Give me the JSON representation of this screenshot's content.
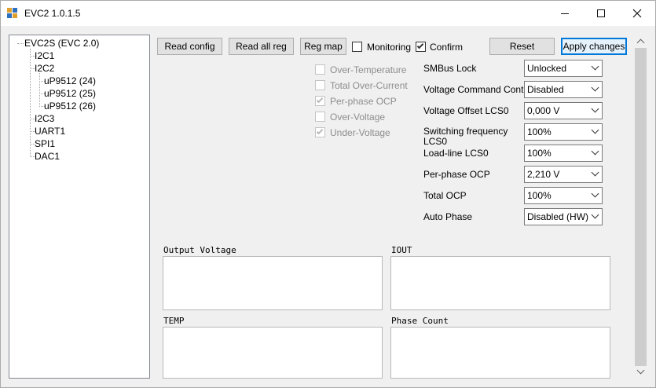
{
  "window": {
    "title": "EVC2 1.0.1.5"
  },
  "tree": {
    "items": [
      {
        "label": "EVC2S (EVC 2.0)"
      },
      {
        "label": "I2C1"
      },
      {
        "label": "I2C2"
      },
      {
        "label": "uP9512 (24)"
      },
      {
        "label": "uP9512 (25)"
      },
      {
        "label": "uP9512 (26)"
      },
      {
        "label": "I2C3"
      },
      {
        "label": "UART1"
      },
      {
        "label": "SPI1"
      },
      {
        "label": "DAC1"
      }
    ]
  },
  "toolbar": {
    "read_config": "Read config",
    "read_all_reg": "Read all reg",
    "reg_map": "Reg map",
    "monitoring": {
      "label": "Monitoring",
      "checked": false
    },
    "confirm": {
      "label": "Confirm",
      "checked": true
    },
    "reset": "Reset",
    "apply_changes": "Apply changes"
  },
  "protections": [
    {
      "label": "Over-Temperature",
      "checked": false
    },
    {
      "label": "Total Over-Current",
      "checked": false
    },
    {
      "label": "Per-phase OCP",
      "checked": true
    },
    {
      "label": "Over-Voltage",
      "checked": false
    },
    {
      "label": "Under-Voltage",
      "checked": true
    }
  ],
  "settings": [
    {
      "label": "SMBus Lock",
      "value": "Unlocked"
    },
    {
      "label": "Voltage Command Control",
      "value": "Disabled"
    },
    {
      "label": "Voltage Offset LCS0",
      "value": "0,000 V"
    },
    {
      "label": "Switching frequency LCS0",
      "value": "100%"
    },
    {
      "label": "Load-line LCS0",
      "value": "100%"
    },
    {
      "label": "Per-phase OCP",
      "value": "2,210 V"
    },
    {
      "label": "Total OCP",
      "value": "100%"
    },
    {
      "label": "Auto Phase",
      "value": "Disabled (HW)"
    }
  ],
  "panels": {
    "output_voltage": "Output Voltage",
    "iout": "IOUT",
    "temp": "TEMP",
    "phase_count": "Phase Count"
  }
}
